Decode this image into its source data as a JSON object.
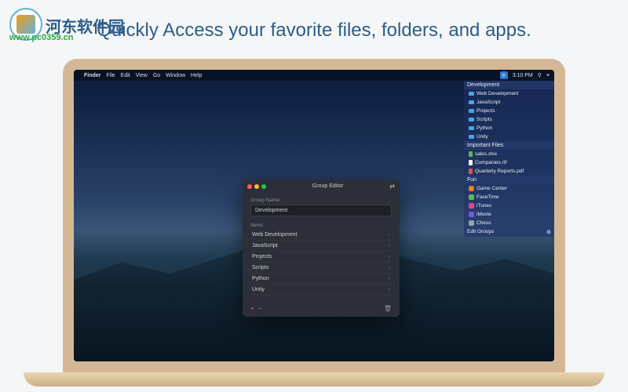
{
  "watermark": {
    "site_name": "河东软件园",
    "url": "www.pc0359.cn"
  },
  "headline": "Quickly Access your favorite files, folders, and apps.",
  "menubar": {
    "app": "Finder",
    "items": [
      "File",
      "Edit",
      "View",
      "Go",
      "Window",
      "Help"
    ],
    "time": "3:10 PM",
    "search_icon": "⚲",
    "list_icon": "≡"
  },
  "sidebar": {
    "groups": [
      {
        "title": "Development",
        "items": [
          {
            "icon": "folder",
            "label": "Web Development"
          },
          {
            "icon": "folder",
            "label": "JavaScript"
          },
          {
            "icon": "folder",
            "label": "Projects"
          },
          {
            "icon": "folder",
            "label": "Scripts"
          },
          {
            "icon": "folder",
            "label": "Python"
          },
          {
            "icon": "folder",
            "label": "Unity"
          }
        ]
      },
      {
        "title": "Important Files",
        "items": [
          {
            "icon": "file-green",
            "label": "sales.xlsx"
          },
          {
            "icon": "file",
            "label": "Companies.rtf"
          },
          {
            "icon": "file-red",
            "label": "Quarterly Reports.pdf"
          }
        ]
      },
      {
        "title": "Fun",
        "items": [
          {
            "icon": "app-gc",
            "label": "Game Center"
          },
          {
            "icon": "app-ft",
            "label": "FaceTime"
          },
          {
            "icon": "app-it",
            "label": "iTunes"
          },
          {
            "icon": "app-im",
            "label": "iMovie"
          },
          {
            "icon": "app-ch",
            "label": "Chess"
          }
        ]
      }
    ],
    "footer_label": "Edit Groups",
    "footer_icon": "⚙"
  },
  "editor": {
    "window_title": "Group Editor",
    "nav_icon": "⇄",
    "field_label": "Group Name",
    "field_value": "Development",
    "items_label": "Items",
    "rows": [
      "Web Development",
      "JavaScript",
      "Projects",
      "Scripts",
      "Python",
      "Unity"
    ],
    "chevron": "›",
    "add": "+",
    "remove": "−",
    "trash": "🗑"
  }
}
